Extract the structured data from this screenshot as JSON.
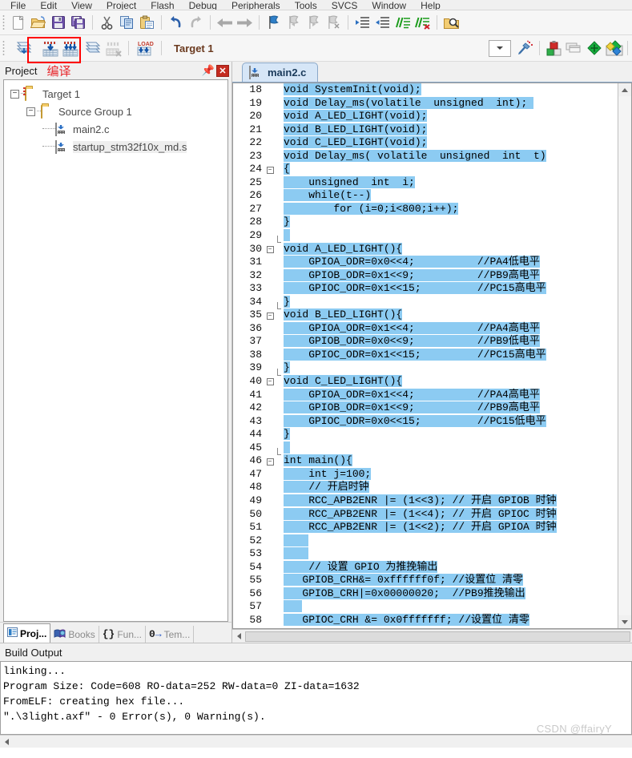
{
  "window": {
    "app": "Keil uVision",
    "watermark": "CSDN @ffairyY"
  },
  "menubar": {
    "items": [
      "File",
      "Edit",
      "View",
      "Project",
      "Flash",
      "Debug",
      "Peripherals",
      "Tools",
      "SVCS",
      "Window",
      "Help"
    ]
  },
  "toolbar1": {
    "buttons": [
      {
        "name": "new-file-icon",
        "label": "New"
      },
      {
        "name": "open-file-icon",
        "label": "Open"
      },
      {
        "name": "save-icon",
        "label": "Save"
      },
      {
        "name": "save-all-icon",
        "label": "Save All"
      },
      {
        "name": "cut-icon",
        "label": "Cut"
      },
      {
        "name": "copy-icon",
        "label": "Copy"
      },
      {
        "name": "paste-icon",
        "label": "Paste"
      },
      {
        "name": "undo-icon",
        "label": "Undo"
      },
      {
        "name": "redo-icon",
        "label": "Redo"
      },
      {
        "name": "navigate-back-icon",
        "label": "Back"
      },
      {
        "name": "navigate-forward-icon",
        "label": "Forward"
      },
      {
        "name": "bookmark-toggle-icon",
        "label": "Insert/Remove Bookmark"
      },
      {
        "name": "bookmark-prev-icon",
        "label": "Previous Bookmark"
      },
      {
        "name": "bookmark-next-icon",
        "label": "Next Bookmark"
      },
      {
        "name": "bookmark-clear-icon",
        "label": "Clear All Bookmarks"
      },
      {
        "name": "indent-right-icon",
        "label": "Indent"
      },
      {
        "name": "indent-left-icon",
        "label": "Outdent"
      },
      {
        "name": "comment-icon",
        "label": "Comment"
      },
      {
        "name": "uncomment-icon",
        "label": "Uncomment"
      },
      {
        "name": "find-in-files-icon",
        "label": "Find in Files"
      }
    ]
  },
  "toolbar2": {
    "buttons": [
      {
        "name": "translate-icon",
        "label": "Translate Current File"
      },
      {
        "name": "build-icon",
        "label": "Build"
      },
      {
        "name": "rebuild-icon",
        "label": "Rebuild All"
      },
      {
        "name": "batch-build-icon",
        "label": "Batch Build"
      },
      {
        "name": "stop-build-icon",
        "label": "Stop Build"
      },
      {
        "name": "download-icon",
        "label": "Download"
      }
    ],
    "target_label": "Target 1",
    "right_buttons": [
      {
        "name": "target-options-icon",
        "label": "Options for Target"
      },
      {
        "name": "manage-project-items-icon",
        "label": "Manage Project Items"
      },
      {
        "name": "multi-project-icon",
        "label": "Manage Multi-Project"
      },
      {
        "name": "pack-installer-icon",
        "label": "Pack Installer"
      },
      {
        "name": "run-utility-icon",
        "label": "Manage Run-Time Environment"
      }
    ],
    "annotation": "编译"
  },
  "project_panel": {
    "title": "Project",
    "annotation": "编译",
    "pin_icon": "pin-icon",
    "close_icon": "close-icon",
    "tree": [
      {
        "label": "Target 1",
        "icon": "target-folder-icon",
        "depth": 0,
        "expander": "-",
        "selected": false
      },
      {
        "label": "Source Group 1",
        "icon": "folder-icon",
        "depth": 1,
        "expander": "-",
        "selected": false
      },
      {
        "label": "main2.c",
        "icon": "c-file-icon",
        "depth": 2,
        "expander": "",
        "selected": false
      },
      {
        "label": "startup_stm32f10x_md.s",
        "icon": "asm-file-icon",
        "depth": 2,
        "expander": "",
        "selected": true
      }
    ],
    "tabs": [
      {
        "label": "Proj...",
        "icon": "project-icon",
        "active": true
      },
      {
        "label": "Books",
        "icon": "books-icon",
        "active": false
      },
      {
        "label": "Fun...",
        "icon": "functions-icon",
        "active": false
      },
      {
        "label": "Tem...",
        "icon": "templates-icon",
        "active": false
      }
    ]
  },
  "editor": {
    "tab_label": "main2.c",
    "tab_icon": "c-file-icon",
    "first_line_number": 18,
    "lines": [
      {
        "n": 18,
        "fold": "",
        "gutter": "",
        "segs": [
          {
            "t": "void SystemInit(void);",
            "sel": true
          }
        ]
      },
      {
        "n": 19,
        "fold": "",
        "gutter": "",
        "segs": [
          {
            "t": "void Delay_ms(volatile  unsigned  int); ",
            "sel": true
          }
        ]
      },
      {
        "n": 20,
        "fold": "",
        "gutter": "",
        "segs": [
          {
            "t": "void A_LED_LIGHT(void);",
            "sel": true
          }
        ]
      },
      {
        "n": 21,
        "fold": "",
        "gutter": "",
        "segs": [
          {
            "t": "void B_LED_LIGHT(void);",
            "sel": true
          }
        ]
      },
      {
        "n": 22,
        "fold": "",
        "gutter": "",
        "segs": [
          {
            "t": "void C_LED_LIGHT(void);",
            "sel": true
          }
        ]
      },
      {
        "n": 23,
        "fold": "",
        "gutter": "",
        "segs": [
          {
            "t": "void Delay_ms( volatile  unsigned  int  t)",
            "sel": true
          }
        ]
      },
      {
        "n": 24,
        "fold": "-",
        "gutter": "",
        "segs": [
          {
            "t": "{",
            "sel": true
          }
        ]
      },
      {
        "n": 25,
        "fold": "",
        "gutter": "bar",
        "segs": [
          {
            "t": "    unsigned  int  i;",
            "sel": true
          }
        ]
      },
      {
        "n": 26,
        "fold": "",
        "gutter": "bar",
        "segs": [
          {
            "t": "    while(t--)",
            "sel": true
          }
        ]
      },
      {
        "n": 27,
        "fold": "",
        "gutter": "bar",
        "segs": [
          {
            "t": "        for (i=0;i<800;i++);",
            "sel": true
          }
        ]
      },
      {
        "n": 28,
        "fold": "",
        "gutter": "bar",
        "segs": [
          {
            "t": "}",
            "sel": true
          }
        ]
      },
      {
        "n": 29,
        "fold": "",
        "gutter": "barend",
        "segs": [
          {
            "t": " ",
            "sel": true
          }
        ]
      },
      {
        "n": 30,
        "fold": "-",
        "gutter": "",
        "segs": [
          {
            "t": "void A_LED_LIGHT(){",
            "sel": true
          }
        ]
      },
      {
        "n": 31,
        "fold": "",
        "gutter": "bar",
        "segs": [
          {
            "t": "    GPIOA_ODR=0x0<<4;          //PA4低电平",
            "sel": true
          }
        ]
      },
      {
        "n": 32,
        "fold": "",
        "gutter": "bar",
        "segs": [
          {
            "t": "    GPIOB_ODR=0x1<<9;          //PB9高电平",
            "sel": true
          }
        ]
      },
      {
        "n": 33,
        "fold": "",
        "gutter": "bar",
        "segs": [
          {
            "t": "    GPIOC_ODR=0x1<<15;         //PC15高电平",
            "sel": true
          }
        ]
      },
      {
        "n": 34,
        "fold": "",
        "gutter": "barend",
        "segs": [
          {
            "t": "}",
            "sel": true
          }
        ]
      },
      {
        "n": 35,
        "fold": "-",
        "gutter": "",
        "segs": [
          {
            "t": "void B_LED_LIGHT(){",
            "sel": true
          }
        ]
      },
      {
        "n": 36,
        "fold": "",
        "gutter": "bar",
        "segs": [
          {
            "t": "    GPIOA_ODR=0x1<<4;          //PA4高电平",
            "sel": true
          }
        ]
      },
      {
        "n": 37,
        "fold": "",
        "gutter": "bar",
        "segs": [
          {
            "t": "    GPIOB_ODR=0x0<<9;          //PB9低电平",
            "sel": true
          }
        ]
      },
      {
        "n": 38,
        "fold": "",
        "gutter": "bar",
        "segs": [
          {
            "t": "    GPIOC_ODR=0x1<<15;         //PC15高电平",
            "sel": true
          }
        ]
      },
      {
        "n": 39,
        "fold": "",
        "gutter": "barend",
        "segs": [
          {
            "t": "}",
            "sel": true
          }
        ]
      },
      {
        "n": 40,
        "fold": "-",
        "gutter": "",
        "segs": [
          {
            "t": "void C_LED_LIGHT(){",
            "sel": true
          }
        ]
      },
      {
        "n": 41,
        "fold": "",
        "gutter": "bar",
        "segs": [
          {
            "t": "    GPIOA_ODR=0x1<<4;          //PA4高电平",
            "sel": true
          }
        ]
      },
      {
        "n": 42,
        "fold": "",
        "gutter": "bar",
        "segs": [
          {
            "t": "    GPIOB_ODR=0x1<<9;          //PB9高电平",
            "sel": true
          }
        ]
      },
      {
        "n": 43,
        "fold": "",
        "gutter": "bar",
        "segs": [
          {
            "t": "    GPIOC_ODR=0x0<<15;         //PC15低电平",
            "sel": true
          }
        ]
      },
      {
        "n": 44,
        "fold": "",
        "gutter": "bar",
        "segs": [
          {
            "t": "}",
            "sel": true
          }
        ]
      },
      {
        "n": 45,
        "fold": "",
        "gutter": "barend",
        "segs": [
          {
            "t": " ",
            "sel": true
          }
        ]
      },
      {
        "n": 46,
        "fold": "-",
        "gutter": "",
        "segs": [
          {
            "t": "int main(){",
            "sel": true
          }
        ]
      },
      {
        "n": 47,
        "fold": "",
        "gutter": "bar",
        "segs": [
          {
            "t": "    int j=100;",
            "sel": true
          }
        ]
      },
      {
        "n": 48,
        "fold": "",
        "gutter": "bar",
        "segs": [
          {
            "t": "    // 开启时钟",
            "sel": true
          }
        ]
      },
      {
        "n": 49,
        "fold": "",
        "gutter": "bar",
        "segs": [
          {
            "t": "    RCC_APB2ENR |= (1<<3); // 开启 GPIOB 时钟",
            "sel": true
          }
        ]
      },
      {
        "n": 50,
        "fold": "",
        "gutter": "bar",
        "segs": [
          {
            "t": "    RCC_APB2ENR |= (1<<4); // 开启 GPIOC 时钟",
            "sel": true
          }
        ]
      },
      {
        "n": 51,
        "fold": "",
        "gutter": "bar",
        "segs": [
          {
            "t": "    RCC_APB2ENR |= (1<<2); // 开启 GPIOA 时钟",
            "sel": true
          }
        ]
      },
      {
        "n": 52,
        "fold": "",
        "gutter": "bar",
        "segs": [
          {
            "t": "    ",
            "sel": true
          }
        ]
      },
      {
        "n": 53,
        "fold": "",
        "gutter": "bar",
        "segs": [
          {
            "t": "    ",
            "sel": true
          }
        ]
      },
      {
        "n": 54,
        "fold": "",
        "gutter": "bar",
        "segs": [
          {
            "t": "    // 设置 GPIO 为推挽输出",
            "sel": true
          }
        ]
      },
      {
        "n": 55,
        "fold": "",
        "gutter": "bar",
        "segs": [
          {
            "t": "   GPIOB_CRH&= 0xffffff0f; //设置位 清零",
            "sel": true
          }
        ]
      },
      {
        "n": 56,
        "fold": "",
        "gutter": "bar",
        "segs": [
          {
            "t": "   GPIOB_CRH|=0x00000020;  //PB9推挽输出",
            "sel": true
          }
        ]
      },
      {
        "n": 57,
        "fold": "",
        "gutter": "bar",
        "segs": [
          {
            "t": "   ",
            "sel": true
          }
        ]
      },
      {
        "n": 58,
        "fold": "",
        "gutter": "bar",
        "segs": [
          {
            "t": "   GPIOC_CRH &= 0x0fffffff; //设置位 清零",
            "sel": true
          }
        ]
      }
    ]
  },
  "build_output": {
    "title": "Build Output",
    "lines": [
      "linking...",
      "Program Size: Code=608 RO-data=252 RW-data=0 ZI-data=1632",
      "FromELF: creating hex file...",
      "\".\\3light.axf\" - 0 Error(s), 0 Warning(s)."
    ]
  },
  "colors": {
    "selection": "#8ccbf2",
    "annotation_red": "#e8272c",
    "tab_blue": "#d6e6f7",
    "target_text": "#6b3a1f"
  }
}
